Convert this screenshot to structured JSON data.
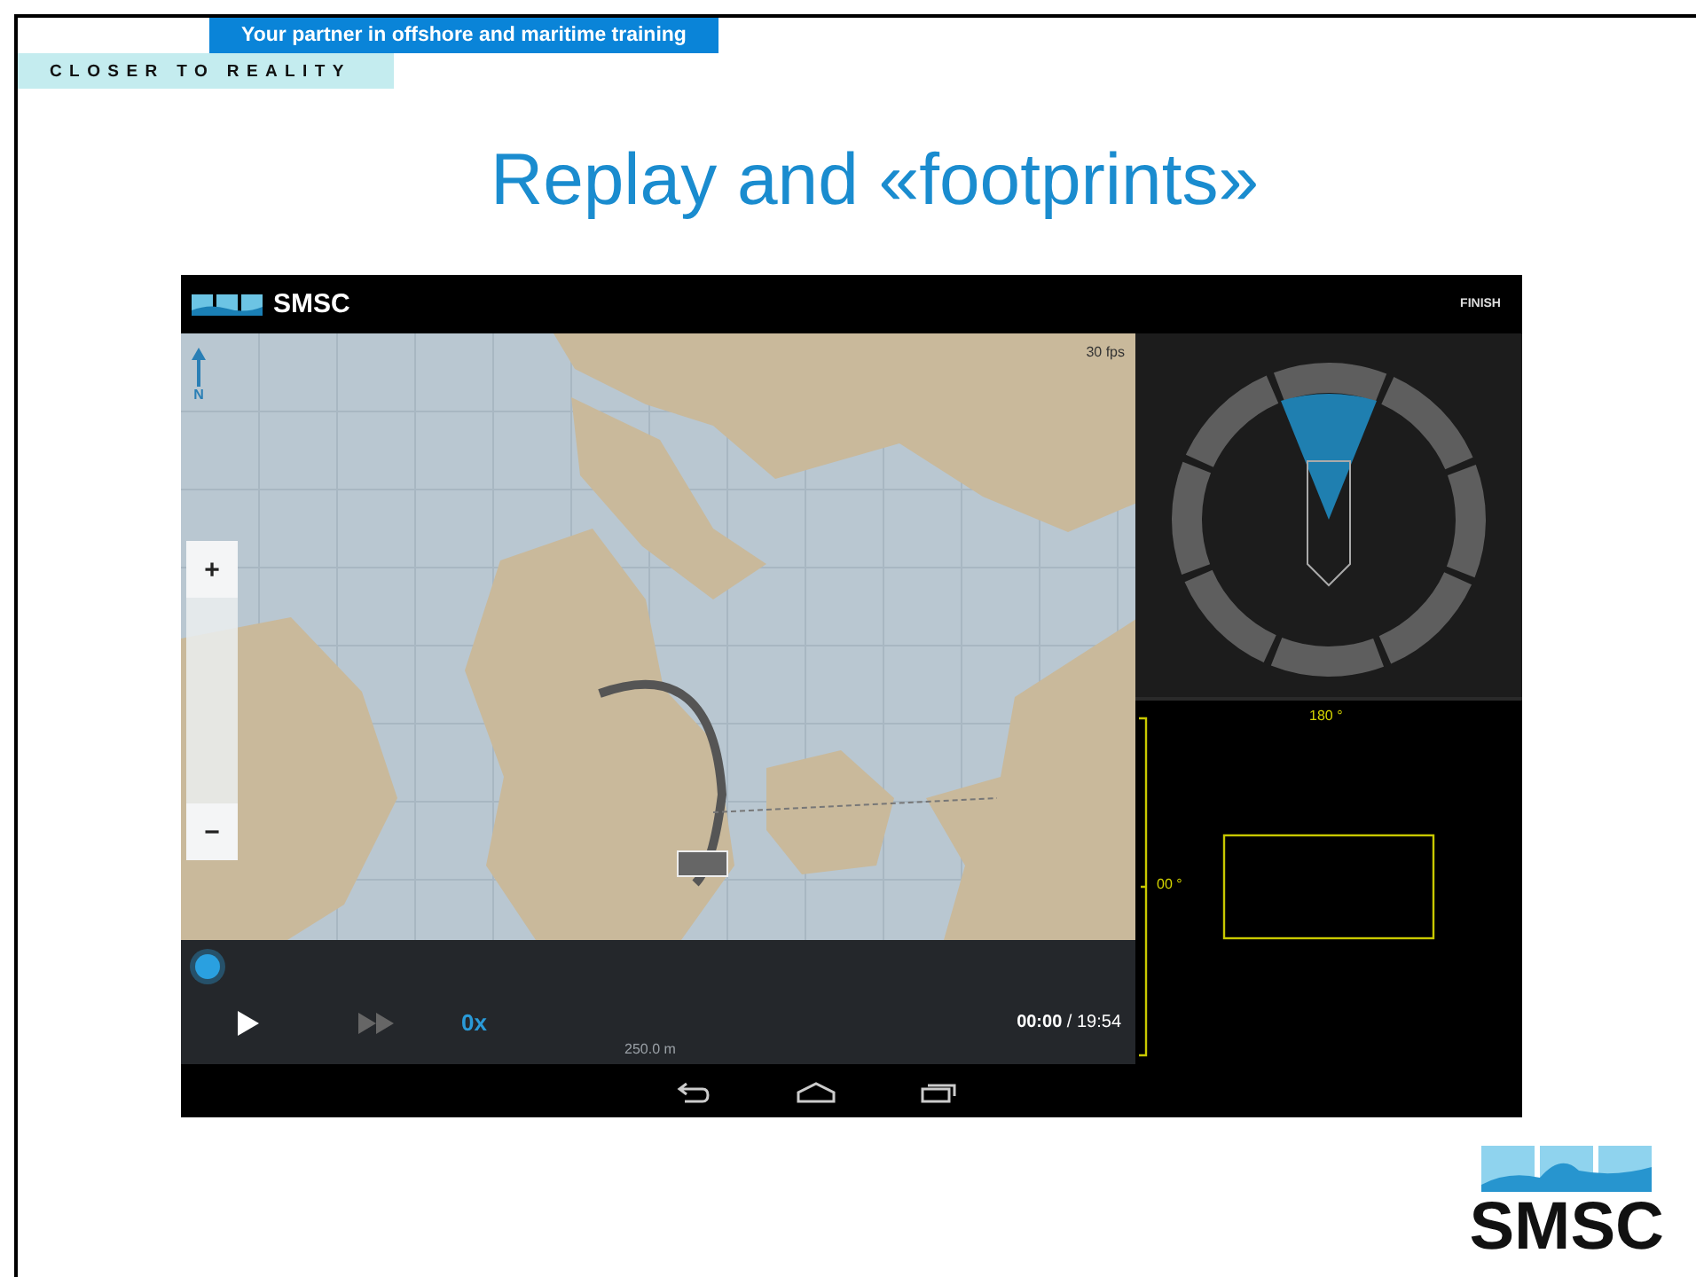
{
  "slide": {
    "tagline": "Your partner in offshore and maritime training",
    "motto": "CLOSER TO REALITY",
    "title": "Replay and «footprints»",
    "logo_text": "SMSC"
  },
  "app": {
    "header": {
      "brand": "SMSC",
      "action": "FINISH"
    },
    "map": {
      "north": "N",
      "fps": "30 fps",
      "zoom_in": "+",
      "zoom_out": "−",
      "scale": "250.0 m"
    },
    "player": {
      "timeline": {
        "level": 0
      },
      "speed": "0x",
      "time": "**00:00** / 19:54"
    },
    "radar": {
      "top_label": "180 °",
      "side_label": "00 °"
    }
  }
}
